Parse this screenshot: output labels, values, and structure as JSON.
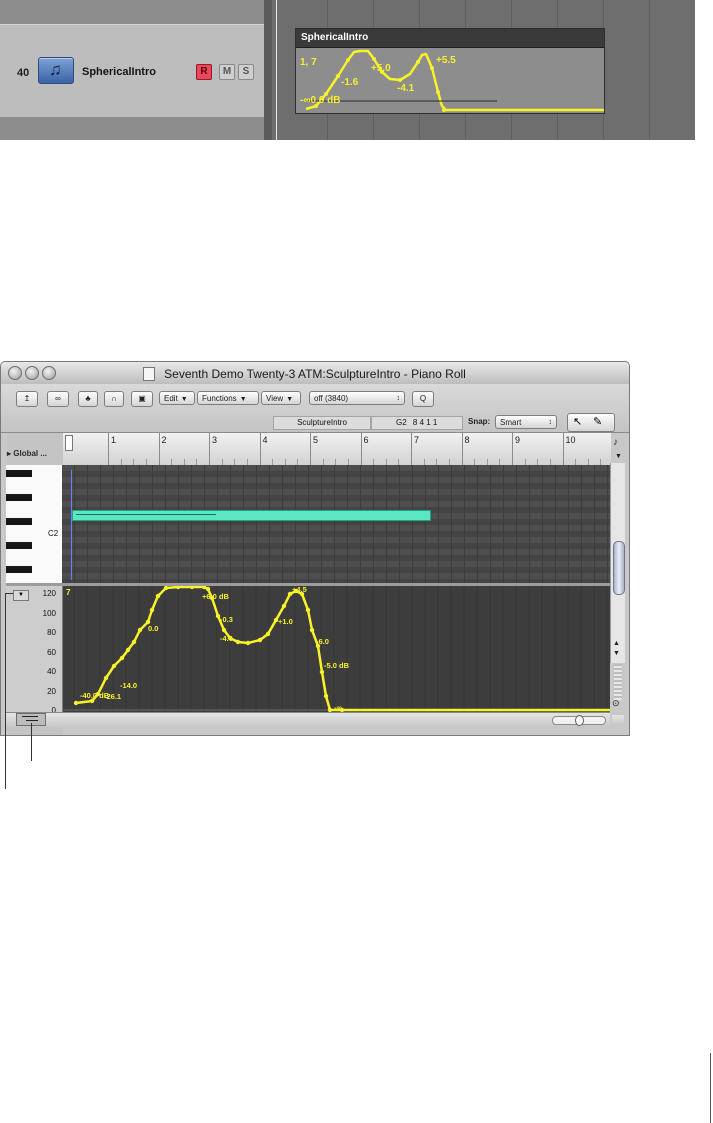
{
  "arrange": {
    "track_number": "40",
    "track_name": "SphericalIntro",
    "record_label": "R",
    "mute_label": "M",
    "solo_label": "S",
    "region_name": "SphericalIntro",
    "automation_labels": [
      "1, 7",
      "-1.6",
      "+5.0",
      "-4.1",
      "+5.5",
      "-∞0.0 dB"
    ]
  },
  "piano_roll": {
    "window_title": "Seventh Demo Twenty-3 ATM:SculptureIntro - Piano Roll",
    "toolbar": {
      "edit_menu": "Edit",
      "functions_menu": "Functions",
      "view_menu": "View",
      "quantize_value": "off (3840)",
      "q_button": "Q",
      "region_name": "SculptureIntro",
      "note_pitch": "G2",
      "note_position": "8 4 1 1",
      "snap_label": "Snap:",
      "snap_value": "Smart"
    },
    "global_tracks_label": "Global ...",
    "ruler_bars": [
      "1",
      "2",
      "3",
      "4",
      "5",
      "6",
      "7",
      "8",
      "9",
      "10"
    ],
    "key_label": "C2",
    "value_axis": [
      "120",
      "100",
      "80",
      "60",
      "40",
      "20",
      "0"
    ],
    "automation_value": "7",
    "automation_labels": [
      "+6.0 dB",
      "0.0",
      "-0.3",
      "-4.6",
      "+1.0",
      "+4.5",
      "-6.0",
      "-5.0 dB",
      "-14.0",
      "-40.0 dB",
      "-26.1",
      "-∞"
    ]
  },
  "colors": {
    "automation_curve": "#f8f22a",
    "note_fill": "#5be7c1",
    "record_button": "#e8495c"
  }
}
